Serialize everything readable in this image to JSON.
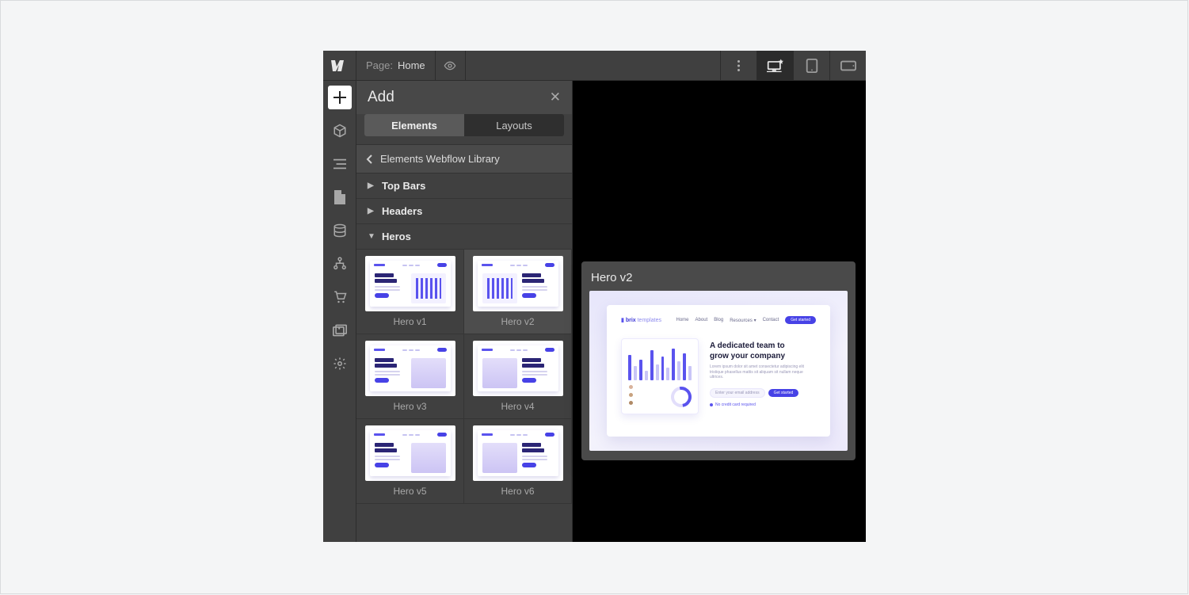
{
  "topbar": {
    "page_label": "Page:",
    "page_name": "Home"
  },
  "panel": {
    "title": "Add",
    "tab_elements": "Elements",
    "tab_layouts": "Layouts",
    "breadcrumb": "Elements Webflow Library",
    "categories": [
      {
        "label": "Top Bars",
        "expanded": false
      },
      {
        "label": "Headers",
        "expanded": false
      },
      {
        "label": "Heros",
        "expanded": true
      }
    ],
    "heros": [
      {
        "label": "Hero v1",
        "selected": false,
        "media": "bars",
        "imgside": "right"
      },
      {
        "label": "Hero v2",
        "selected": true,
        "media": "bars",
        "imgside": "left"
      },
      {
        "label": "Hero v3",
        "selected": false,
        "media": "photo",
        "imgside": "right"
      },
      {
        "label": "Hero v4",
        "selected": false,
        "media": "photo",
        "imgside": "left"
      },
      {
        "label": "Hero v5",
        "selected": false,
        "media": "photo",
        "imgside": "right"
      },
      {
        "label": "Hero v6",
        "selected": false,
        "media": "photo",
        "imgside": "left"
      }
    ]
  },
  "flyout": {
    "title": "Hero v2",
    "preview": {
      "brand_a": "brix",
      "brand_b": "templates",
      "nav": [
        "Home",
        "About",
        "Blog",
        "Resources ▾",
        "Contact"
      ],
      "nav_cta": "Get started",
      "headline_line1": "A dedicated team to",
      "headline_line2": "grow your company",
      "subcopy": "Lorem ipsum dolor sit amet consectetur adipiscing elit tristique phasellus mattis sit aliquam sit nullam neque ultrices.",
      "input_placeholder": "Enter your email address",
      "subscribe_cta": "Get started",
      "footnote": "No credit card required"
    }
  }
}
